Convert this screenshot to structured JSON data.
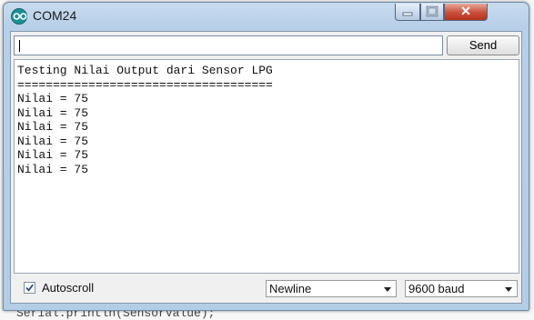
{
  "window": {
    "title": "COM24"
  },
  "input": {
    "value": ""
  },
  "send_label": "Send",
  "output_lines": [
    "Testing Nilai Output dari Sensor LPG",
    "====================================",
    "Nilai = 75",
    "Nilai = 75",
    "Nilai = 75",
    "Nilai = 75",
    "Nilai = 75",
    "Nilai = 75"
  ],
  "autoscroll": {
    "label": "Autoscroll",
    "checked": true
  },
  "line_ending": {
    "selected": "Newline"
  },
  "baud": {
    "selected": "9600 baud"
  },
  "background_code": {
    "bottom": "Serial.println(SensorValue);"
  },
  "colors": {
    "app_icon": "#1d8f94",
    "close_button": "#c84f3a",
    "title_bar": "#c9dcef"
  }
}
